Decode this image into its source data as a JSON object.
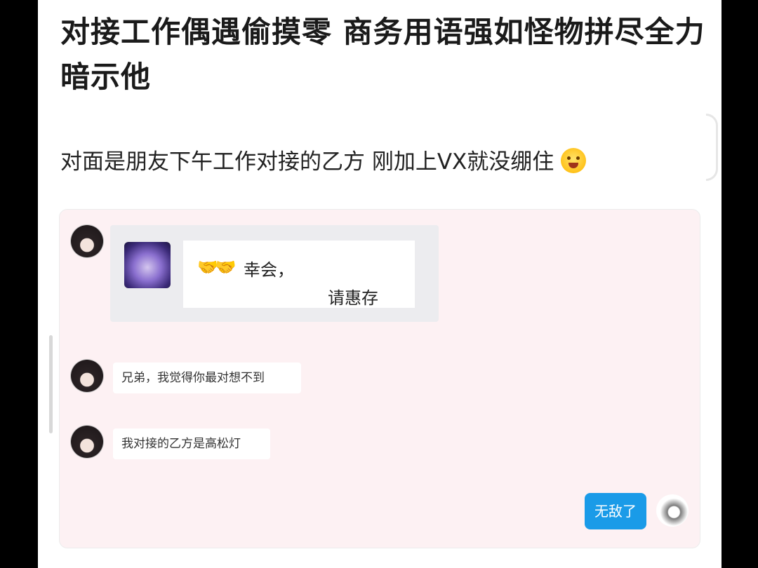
{
  "post": {
    "title": "对接工作偶遇偷摸零 商务用语强如怪物拼尽全力暗示他",
    "description": "对面是朋友下午工作对接的乙方 刚加上VX就没绷住"
  },
  "chat": {
    "shared_card": {
      "greeting_emoji": "🤝🤝",
      "greeting": "幸会，",
      "reply": "请惠存"
    },
    "messages": [
      {
        "text": "兄弟，我觉得你最对想不到"
      },
      {
        "text": "我对接的乙方是高松灯"
      },
      {
        "text": "无敌了"
      }
    ]
  },
  "colors": {
    "chat_background": "#fdf1f3",
    "sent_bubble": "#1a9be8"
  }
}
